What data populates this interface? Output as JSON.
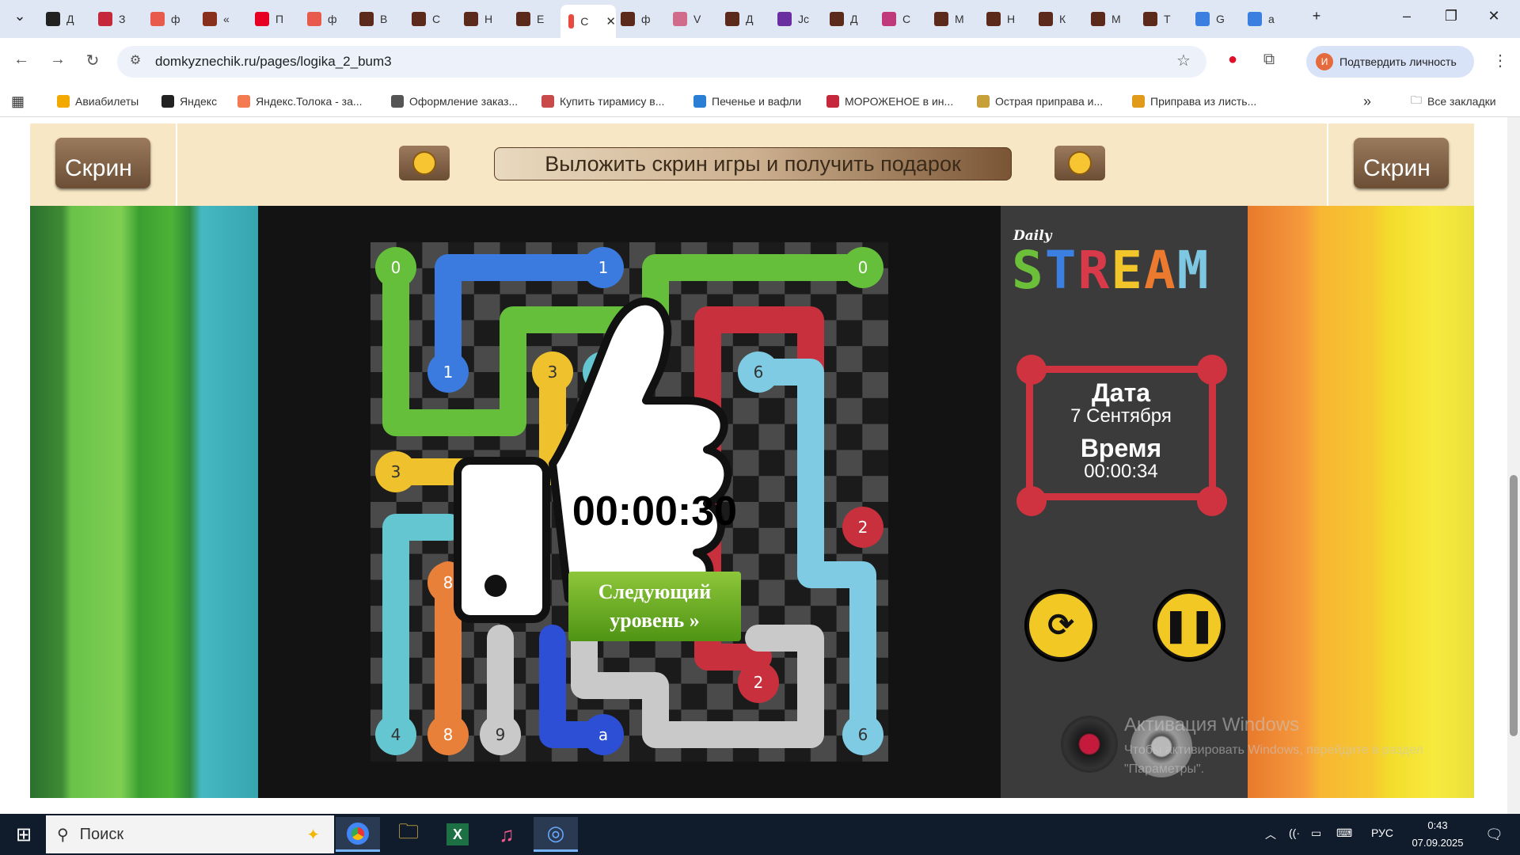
{
  "browser": {
    "tabs": [
      {
        "label": "Д",
        "color": "#222"
      },
      {
        "label": "З",
        "color": "#c4283a"
      },
      {
        "label": "ф",
        "color": "#e85b4c"
      },
      {
        "label": "«",
        "color": "#8a2f1e"
      },
      {
        "label": "П",
        "color": "#e60023"
      },
      {
        "label": "ф",
        "color": "#e85b4c"
      },
      {
        "label": "В",
        "color": "#5b2a1a"
      },
      {
        "label": "С",
        "color": "#5b2a1a"
      },
      {
        "label": "Н",
        "color": "#5b2a1a"
      },
      {
        "label": "Е",
        "color": "#5b2a1a"
      },
      {
        "label": "С",
        "color": "#e94a3f",
        "active": true
      },
      {
        "label": "ф",
        "color": "#5b2a1a"
      },
      {
        "label": "V",
        "color": "#d06b8b"
      },
      {
        "label": "Д",
        "color": "#5b2a1a"
      },
      {
        "label": "Јс",
        "color": "#6a2ea0"
      },
      {
        "label": "Д",
        "color": "#5b2a1a"
      },
      {
        "label": "С",
        "color": "#c0397a"
      },
      {
        "label": "М",
        "color": "#5b2a1a"
      },
      {
        "label": "Н",
        "color": "#5b2a1a"
      },
      {
        "label": "К",
        "color": "#5b2a1a"
      },
      {
        "label": "М",
        "color": "#5b2a1a"
      },
      {
        "label": "Т",
        "color": "#5b2a1a"
      },
      {
        "label": "G",
        "color": "#3b7fe0"
      },
      {
        "label": "a",
        "color": "#3b7fe0"
      }
    ],
    "url": "domkyznechik.ru/pages/logika_2_bum3",
    "verify_label": "Подтвердить личность",
    "avatar_letter": "И",
    "bookmarks": [
      {
        "label": "Авиабилеты",
        "color": "#f2a900"
      },
      {
        "label": "Яндекс",
        "color": "#222"
      },
      {
        "label": "Яндекс.Толока - за...",
        "color": "#f47b50"
      },
      {
        "label": "Оформление заказ...",
        "color": "#555"
      },
      {
        "label": "Купить тирамису в...",
        "color": "#c94a4a"
      },
      {
        "label": "Печенье и вафли",
        "color": "#2a7fd4"
      },
      {
        "label": "МОРОЖЕНОЕ в ин...",
        "color": "#c4283a"
      },
      {
        "label": "Острая приправа и...",
        "color": "#c8a03a"
      },
      {
        "label": "Приправа из листь...",
        "color": "#e29a1a"
      }
    ],
    "all_bookmarks": "Все закладки"
  },
  "banner": {
    "skrin_left": "Скрин",
    "skrin_right": "Скрин",
    "post_button": "Выложить скрин игры и получить подарок"
  },
  "game": {
    "title_small": "Daily",
    "title_big": "STREAM",
    "date_label": "Дата",
    "date_value": "7 Сентября",
    "time_label": "Время",
    "time_value": "00:00:34",
    "popup_time": "00:00:30",
    "next_level": "Следующий уровень »",
    "next_level_line1": "Следующий",
    "next_level_line2": "уровень »",
    "colors": {
      "green": "#66bf3a",
      "blue": "#3b7be0",
      "red": "#c8303e",
      "yellow": "#eec12d",
      "teal": "#64c6d1",
      "lightblue": "#7ecbe3",
      "orange": "#e9803a",
      "gray": "#c9c9c9",
      "darkblue": "#2c4fd6"
    },
    "node_labels": [
      "0",
      "1",
      "0",
      "1",
      "3",
      "4",
      "6",
      "3",
      "2",
      "8",
      "9",
      "a",
      "2",
      "4",
      "8",
      "9",
      "a",
      "6"
    ]
  },
  "watermark": {
    "line1": "Активация Windows",
    "line2": "Чтобы активировать Windows, перейдите в раздел \"Параметры\"."
  },
  "taskbar": {
    "search_placeholder": "Поиск",
    "lang": "РУС",
    "time": "0:43",
    "date": "07.09.2025"
  }
}
